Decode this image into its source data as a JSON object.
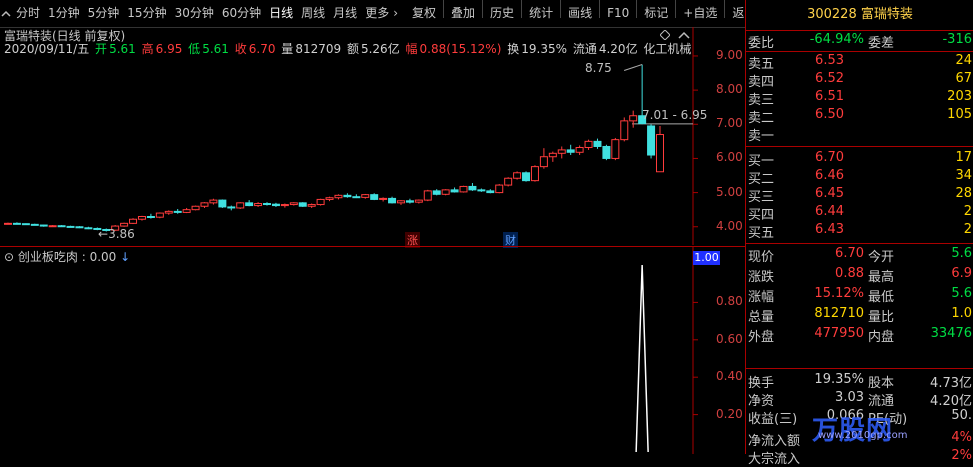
{
  "toolbar": {
    "periods": [
      "分时",
      "1分钟",
      "5分钟",
      "15分钟",
      "30分钟",
      "60分钟",
      "日线",
      "周线",
      "月线",
      "更多"
    ],
    "active_period": "日线",
    "more_suffix": "›",
    "actions": [
      "复权",
      "叠加",
      "历史",
      "统计",
      "画线",
      "F10",
      "标记",
      "+自选",
      "返回"
    ]
  },
  "chart_header": {
    "title": "富瑞特装(日线 前复权)",
    "date": "2020/09/11/五",
    "open_label": "开",
    "open": "5.61",
    "high_label": "高",
    "high": "6.95",
    "low_label": "低",
    "low": "5.61",
    "close_label": "收",
    "close": "6.70",
    "vol_label": "量",
    "vol": "812709",
    "amt_label": "额",
    "amt": "5.26亿",
    "chg_label": "幅",
    "chg": "0.88(15.12%)",
    "turn_label": "换",
    "turn": "19.35%",
    "float_label": "流通",
    "float": "4.20亿",
    "sector": "化工机械"
  },
  "annotations": {
    "peak_label": "8.75",
    "range_label": "7.01 - 6.95",
    "low_label": "3.86",
    "marker_zhang": "涨",
    "marker_cai": "财"
  },
  "main_yticks": [
    "9.00",
    "8.00",
    "7.00",
    "6.00",
    "5.00",
    "4.00"
  ],
  "indicator": {
    "name": "创业板吃肉",
    "value": ": 0.00",
    "arrow": "↓",
    "yticks": [
      "0.80",
      "0.60",
      "0.40",
      "0.20"
    ],
    "cursor_value": "1.00"
  },
  "quote": {
    "code": "300228",
    "name": "富瑞特装",
    "webi_label": "委比",
    "webi": "-64.94%",
    "weicha_label": "委差",
    "weicha": "-316",
    "asks": [
      {
        "label": "卖五",
        "price": "6.53",
        "vol": "24"
      },
      {
        "label": "卖四",
        "price": "6.52",
        "vol": "67"
      },
      {
        "label": "卖三",
        "price": "6.51",
        "vol": "203"
      },
      {
        "label": "卖二",
        "price": "6.50",
        "vol": "105"
      },
      {
        "label": "卖一",
        "price": "",
        "vol": ""
      }
    ],
    "bids": [
      {
        "label": "买一",
        "price": "6.70",
        "vol": "17"
      },
      {
        "label": "买二",
        "price": "6.46",
        "vol": "34"
      },
      {
        "label": "买三",
        "price": "6.45",
        "vol": "28"
      },
      {
        "label": "买四",
        "price": "6.44",
        "vol": "2"
      },
      {
        "label": "买五",
        "price": "6.43",
        "vol": "2"
      }
    ],
    "stats": [
      {
        "l1": "现价",
        "v1": "6.70",
        "l2": "今开",
        "v2": "5.6"
      },
      {
        "l1": "涨跌",
        "v1": "0.88",
        "l2": "最高",
        "v2": "6.9"
      },
      {
        "l1": "涨幅",
        "v1": "15.12%",
        "l2": "最低",
        "v2": "5.6"
      },
      {
        "l1": "总量",
        "v1": "812710",
        "l2": "量比",
        "v2": "1.0"
      },
      {
        "l1": "外盘",
        "v1": "477950",
        "l2": "内盘",
        "v2": "33476"
      }
    ],
    "fin": [
      {
        "l1": "换手",
        "v1": "19.35%",
        "l2": "股本",
        "v2": "4.73亿"
      },
      {
        "l1": "净资",
        "v1": "3.03",
        "l2": "流通",
        "v2": "4.20亿"
      },
      {
        "l1": "收益(三)",
        "v1": "0.066",
        "l2": "PE(动)",
        "v2": "50."
      }
    ],
    "flow": [
      {
        "l1": "净流入额",
        "v2": "4%"
      },
      {
        "l1": "大宗流入",
        "v2": "2%"
      }
    ]
  },
  "watermark": {
    "brand": "万股网",
    "url": "www.2010gp.com"
  },
  "colors": {
    "up": "#ff3c3c",
    "down": "#40e0e0",
    "accent": "#ffd24a",
    "grid": "#aa0000"
  },
  "chart_data": {
    "type": "candlestick",
    "ylim": [
      3.7,
      9.35
    ],
    "candles": [
      [
        4.1,
        4.12,
        4.08,
        4.1
      ],
      [
        4.1,
        4.13,
        4.08,
        4.09
      ],
      [
        4.09,
        4.1,
        4.06,
        4.07
      ],
      [
        4.07,
        4.09,
        4.04,
        4.05
      ],
      [
        4.05,
        4.06,
        4.0,
        4.02
      ],
      [
        4.02,
        4.05,
        4.0,
        4.03
      ],
      [
        4.03,
        4.05,
        4.0,
        4.01
      ],
      [
        4.01,
        4.03,
        3.98,
        4.0
      ],
      [
        4.0,
        4.02,
        3.96,
        3.97
      ],
      [
        3.97,
        4.0,
        3.93,
        3.95
      ],
      [
        3.95,
        3.98,
        3.9,
        3.92
      ],
      [
        3.92,
        3.95,
        3.86,
        3.9
      ],
      [
        3.9,
        4.05,
        3.88,
        4.02
      ],
      [
        4.02,
        4.12,
        4.0,
        4.1
      ],
      [
        4.1,
        4.25,
        4.08,
        4.22
      ],
      [
        4.22,
        4.32,
        4.18,
        4.3
      ],
      [
        4.3,
        4.38,
        4.24,
        4.28
      ],
      [
        4.28,
        4.42,
        4.25,
        4.4
      ],
      [
        4.4,
        4.48,
        4.35,
        4.45
      ],
      [
        4.45,
        4.52,
        4.38,
        4.42
      ],
      [
        4.42,
        4.55,
        4.4,
        4.5
      ],
      [
        4.5,
        4.62,
        4.48,
        4.6
      ],
      [
        4.6,
        4.72,
        4.55,
        4.7
      ],
      [
        4.7,
        4.82,
        4.65,
        4.78
      ],
      [
        4.78,
        4.8,
        4.55,
        4.58
      ],
      [
        4.58,
        4.62,
        4.48,
        4.55
      ],
      [
        4.55,
        4.72,
        4.52,
        4.7
      ],
      [
        4.7,
        4.78,
        4.6,
        4.62
      ],
      [
        4.62,
        4.72,
        4.58,
        4.68
      ],
      [
        4.68,
        4.72,
        4.62,
        4.66
      ],
      [
        4.66,
        4.7,
        4.58,
        4.62
      ],
      [
        4.62,
        4.68,
        4.56,
        4.65
      ],
      [
        4.65,
        4.72,
        4.62,
        4.7
      ],
      [
        4.7,
        4.72,
        4.58,
        4.6
      ],
      [
        4.6,
        4.68,
        4.55,
        4.65
      ],
      [
        4.65,
        4.82,
        4.62,
        4.8
      ],
      [
        4.8,
        4.88,
        4.75,
        4.85
      ],
      [
        4.85,
        4.95,
        4.8,
        4.92
      ],
      [
        4.92,
        4.98,
        4.85,
        4.88
      ],
      [
        4.88,
        4.95,
        4.84,
        4.86
      ],
      [
        4.86,
        4.96,
        4.82,
        4.94
      ],
      [
        4.94,
        4.98,
        4.78,
        4.8
      ],
      [
        4.8,
        4.86,
        4.74,
        4.83
      ],
      [
        4.83,
        4.88,
        4.68,
        4.7
      ],
      [
        4.7,
        4.78,
        4.64,
        4.76
      ],
      [
        4.76,
        4.82,
        4.68,
        4.72
      ],
      [
        4.72,
        4.8,
        4.68,
        4.78
      ],
      [
        4.78,
        5.08,
        4.75,
        5.05
      ],
      [
        5.05,
        5.1,
        4.92,
        4.95
      ],
      [
        4.95,
        5.1,
        4.92,
        5.08
      ],
      [
        5.08,
        5.15,
        5.0,
        5.02
      ],
      [
        5.02,
        5.2,
        5.0,
        5.18
      ],
      [
        5.18,
        5.28,
        5.05,
        5.08
      ],
      [
        5.08,
        5.12,
        5.02,
        5.05
      ],
      [
        5.05,
        5.1,
        4.98,
        5.0
      ],
      [
        5.0,
        5.25,
        4.98,
        5.22
      ],
      [
        5.22,
        5.45,
        5.18,
        5.42
      ],
      [
        5.42,
        5.62,
        5.38,
        5.58
      ],
      [
        5.58,
        5.62,
        5.32,
        5.35
      ],
      [
        5.35,
        5.8,
        5.32,
        5.76
      ],
      [
        5.76,
        6.3,
        5.7,
        6.05
      ],
      [
        6.05,
        6.2,
        5.9,
        6.15
      ],
      [
        6.15,
        6.35,
        6.0,
        6.25
      ],
      [
        6.25,
        6.4,
        6.1,
        6.18
      ],
      [
        6.18,
        6.38,
        6.1,
        6.32
      ],
      [
        6.32,
        6.55,
        6.25,
        6.5
      ],
      [
        6.5,
        6.58,
        6.28,
        6.35
      ],
      [
        6.35,
        6.4,
        5.95,
        6.0
      ],
      [
        6.0,
        6.6,
        5.95,
        6.55
      ],
      [
        6.55,
        7.2,
        6.5,
        7.1
      ],
      [
        7.1,
        7.4,
        6.9,
        7.25
      ],
      [
        7.25,
        8.75,
        7.0,
        7.02
      ],
      [
        6.95,
        7.0,
        6.0,
        6.1
      ],
      [
        5.61,
        6.95,
        5.61,
        6.7
      ]
    ],
    "peak_price": 8.75,
    "range_price": 7.01,
    "low_price": 3.86,
    "indicator_values": {
      "ylim": [
        0,
        1.0
      ],
      "spike_index": 71,
      "spike_value": 1.0
    }
  }
}
